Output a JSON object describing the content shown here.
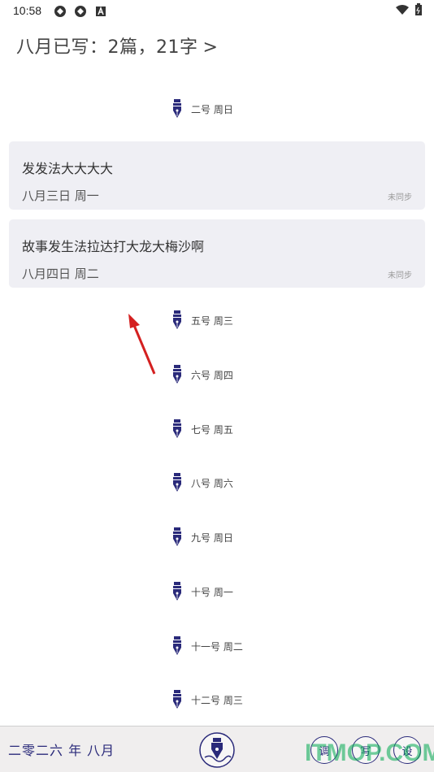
{
  "status_bar": {
    "time": "10:58"
  },
  "header": {
    "summary": "八月已写：2篇，21字",
    "chevron": ">"
  },
  "days": [
    {
      "label": "二号 周日"
    },
    {
      "label": "五号 周三"
    },
    {
      "label": "六号 周四"
    },
    {
      "label": "七号 周五"
    },
    {
      "label": "八号 周六"
    },
    {
      "label": "九号 周日"
    },
    {
      "label": "十号 周一"
    },
    {
      "label": "十一号 周二"
    },
    {
      "label": "十二号 周三"
    }
  ],
  "entries": [
    {
      "title": "发发法大大大大",
      "date": "八月三日  周一",
      "sync": "未同步"
    },
    {
      "title": "故事发生法拉达打大龙大梅沙啊",
      "date": "八月四日  周二",
      "sync": "未同步"
    }
  ],
  "bottom_bar": {
    "month": "二零二六 年 八月",
    "btn1": "调",
    "btn2": "写",
    "btn3": "设"
  },
  "watermark": "ITMOP.COM",
  "colors": {
    "accent": "#2a2a7a",
    "card_bg": "#efeff4",
    "arrow": "#d42020"
  }
}
